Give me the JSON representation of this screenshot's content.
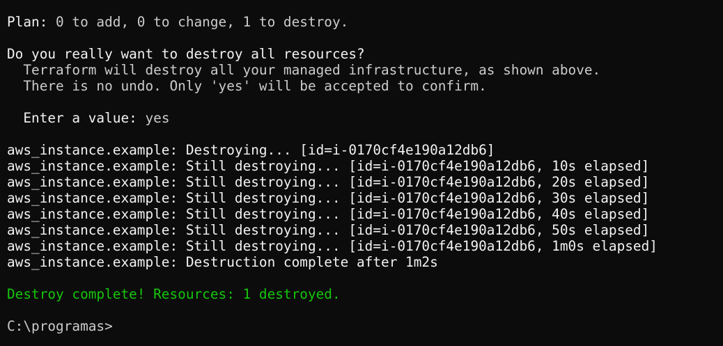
{
  "terminal": {
    "plan": {
      "label": "Plan:",
      "summary": " 0 to add, 0 to change, 1 to destroy."
    },
    "confirm": {
      "question": "Do you really want to destroy all resources?",
      "detail_1": "  Terraform will destroy all your managed infrastructure, as shown above.",
      "detail_2": "  There is no undo. Only 'yes' will be accepted to confirm.",
      "prompt_label": "  Enter a value:",
      "prompt_value": " yes"
    },
    "log": [
      {
        "resource": "aws_instance.example:",
        "message": " Destroying... [id=i-0170cf4e190a12db6]"
      },
      {
        "resource": "aws_instance.example:",
        "message": " Still destroying... [id=i-0170cf4e190a12db6, 10s elapsed]"
      },
      {
        "resource": "aws_instance.example:",
        "message": " Still destroying... [id=i-0170cf4e190a12db6, 20s elapsed]"
      },
      {
        "resource": "aws_instance.example:",
        "message": " Still destroying... [id=i-0170cf4e190a12db6, 30s elapsed]"
      },
      {
        "resource": "aws_instance.example:",
        "message": " Still destroying... [id=i-0170cf4e190a12db6, 40s elapsed]"
      },
      {
        "resource": "aws_instance.example:",
        "message": " Still destroying... [id=i-0170cf4e190a12db6, 50s elapsed]"
      },
      {
        "resource": "aws_instance.example:",
        "message": " Still destroying... [id=i-0170cf4e190a12db6, 1m0s elapsed]"
      },
      {
        "resource": "aws_instance.example:",
        "message": " Destruction complete after 1m2s"
      }
    ],
    "result": "Destroy complete! Resources: 1 destroyed.",
    "shell_prompt": "C:\\programas>"
  },
  "colors": {
    "background": "#0c0c0c",
    "text": "#cccccc",
    "bright_text": "#f2f2f2",
    "success": "#16c60c"
  }
}
